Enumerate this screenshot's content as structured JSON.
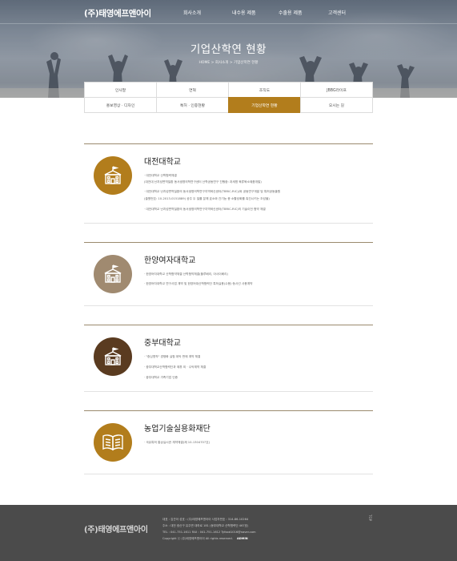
{
  "header": {
    "logo": "(주)태영에프앤아이",
    "nav": [
      "회사소개",
      "내수용 제품",
      "수출용 제품",
      "고객센터"
    ]
  },
  "hero": {
    "title": "기업산학연 현황",
    "breadcrumb": "HOME > 회사소개 > 기업산학연 현황"
  },
  "subnav": {
    "row1": [
      "인사말",
      "연혁",
      "조직도",
      "JBBG라이프"
    ],
    "row2": [
      "홍보영상 · 디자인",
      "특허 · 인증현황",
      "기업산학연 현황",
      "오시는 길"
    ],
    "active": "기업산학연 현황"
  },
  "sections": [
    {
      "name": "대전대학교",
      "icon": "school-icon",
      "color": "#b27d1c",
      "lines": [
        "· 대전대학교 산학협력체결",
        "  (대전대 난치성면역질환 동서생명의학연구센터 산학공동연구 진행중: 과세명 육류육소제품개발)",
        "· 대전대학교 난치성면역질환의 동서생명의학연구지역혁신센터(TBRIC-RIC))와 공동연구개발 및 특허공동출원",
        "  (출원번호: 10-2013-0151889) 공주 두 질를 분해 효소와 간기능 증 소활성화를 촉진시키는 조성물)",
        "· 대전대학교 난치성면역질환의 동서생명의학연구지역혁신센터(TBRIC-RIC)의 기술이전 협약 체결"
      ]
    },
    {
      "name": "한양여자대학교",
      "icon": "school-icon",
      "color": "#a08a70",
      "lines": [
        "· 한양여자대학교 산학협약체결 산학협약체결(플루베리, 아사이베리)",
        "· 한양여자대학교 연구사업 계약 및 한양여대산학협력단 특허실용(수용)·등사선 사용계약"
      ]
    },
    {
      "name": "중부대학교",
      "icon": "school-icon",
      "color": "#5a3b20",
      "lines": [
        "· \"중심명작\" 경쟁화 실험 위탁 판매 계약 체결",
        "· 중부대학교산학협력단과 제휴 외 · 수탁계약 체결",
        "· 중부대학교 가족기업 인증"
      ]
    },
    {
      "name": "농업기술실용화재단",
      "icon": "book-icon",
      "color": "#b27d1c",
      "lines": [
        "· 국유특허 통상실시권 계약체결(제 10-1304707호)"
      ]
    }
  ],
  "footer": {
    "logo": "(주)태영에프앤아이",
    "line1": "대표 : 김관아      성호 : (주)태영에프앤아이      사업자번호 : 314-86-10264",
    "line2": "주소 : 대전 광산구 유주면 대하로 181 (동부대학교 산학협력단 467호)",
    "line3": "TEL : 041-751-1611      FAX : 041-751-1612      Tyfood1016@naver.com",
    "line4": "Copyright ⓒ (주)태영에프앤아이 All rights reserved.",
    "admin": "ADMIN",
    "top": "TOP"
  }
}
